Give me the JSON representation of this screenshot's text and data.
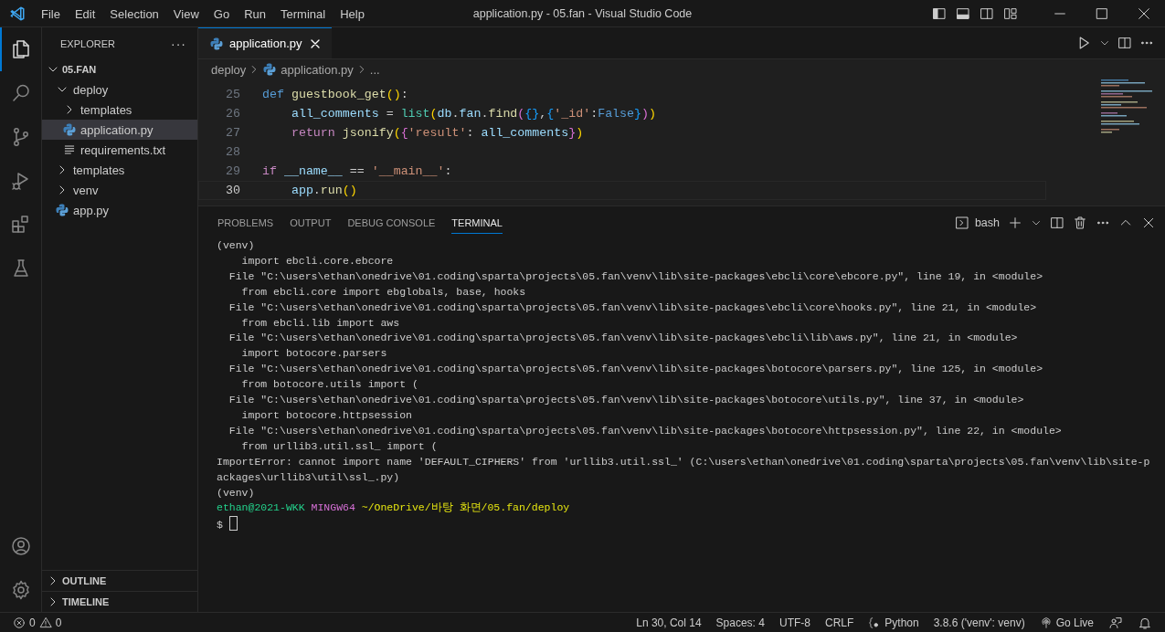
{
  "title_bar": {
    "menu": [
      "File",
      "Edit",
      "Selection",
      "View",
      "Go",
      "Run",
      "Terminal",
      "Help"
    ],
    "title": "application.py - 05.fan - Visual Studio Code"
  },
  "activity_bar": {
    "top": [
      {
        "kind": "explorer",
        "selected": true
      },
      {
        "kind": "search",
        "selected": false
      },
      {
        "kind": "source-control",
        "selected": false
      },
      {
        "kind": "run-debug",
        "selected": false
      },
      {
        "kind": "extensions",
        "selected": false
      },
      {
        "kind": "testing",
        "selected": false
      }
    ],
    "bottom": [
      {
        "kind": "accounts"
      },
      {
        "kind": "settings"
      }
    ]
  },
  "sidebar": {
    "title": "EXPLORER",
    "more": "···",
    "root": {
      "label": "05.FAN",
      "expanded": true
    },
    "items": [
      {
        "label": "deploy",
        "kind": "folder",
        "expanded": true,
        "selected": false,
        "children": [
          {
            "label": "templates",
            "kind": "folder",
            "expanded": false,
            "selected": false
          },
          {
            "label": "application.py",
            "kind": "python",
            "selected": true
          },
          {
            "label": "requirements.txt",
            "kind": "text",
            "selected": false
          }
        ]
      },
      {
        "label": "templates",
        "kind": "folder",
        "expanded": false,
        "selected": false
      },
      {
        "label": "venv",
        "kind": "folder",
        "expanded": false,
        "selected": false
      },
      {
        "label": "app.py",
        "kind": "python",
        "selected": false
      }
    ],
    "sections": [
      {
        "label": "OUTLINE",
        "expanded": false
      },
      {
        "label": "TIMELINE",
        "expanded": false
      }
    ]
  },
  "editor": {
    "tabs": [
      {
        "label": "application.py",
        "kind": "python",
        "selected": true
      }
    ],
    "breadcrumb": [
      {
        "label": "deploy",
        "kind": "folder"
      },
      {
        "label": "application.py",
        "kind": "python"
      },
      {
        "label": "...",
        "kind": "more"
      }
    ],
    "lines": [
      {
        "number": "25",
        "current": false,
        "tokens": [
          {
            "text": "def ",
            "kind": "keyword"
          },
          {
            "text": "guestbook_get",
            "kind": "function"
          },
          {
            "text": "()",
            "kind": "bracket1"
          },
          {
            "text": ":",
            "kind": "plain"
          }
        ]
      },
      {
        "number": "26",
        "current": false,
        "tokens": [
          {
            "text": "    all_comments",
            "kind": "variable"
          },
          {
            "text": " = ",
            "kind": "plain"
          },
          {
            "text": "list",
            "kind": "class"
          },
          {
            "text": "(",
            "kind": "bracket1"
          },
          {
            "text": "db",
            "kind": "variable"
          },
          {
            "text": ".",
            "kind": "plain"
          },
          {
            "text": "fan",
            "kind": "variable"
          },
          {
            "text": ".",
            "kind": "plain"
          },
          {
            "text": "find",
            "kind": "function"
          },
          {
            "text": "(",
            "kind": "bracket2"
          },
          {
            "text": "{}",
            "kind": "bracket3"
          },
          {
            "text": ",",
            "kind": "plain"
          },
          {
            "text": "{",
            "kind": "bracket3"
          },
          {
            "text": "'_id'",
            "kind": "string"
          },
          {
            "text": ":",
            "kind": "plain"
          },
          {
            "text": "False",
            "kind": "keyword"
          },
          {
            "text": "}",
            "kind": "bracket3"
          },
          {
            "text": ")",
            "kind": "bracket2"
          },
          {
            "text": ")",
            "kind": "bracket1"
          }
        ]
      },
      {
        "number": "27",
        "current": false,
        "tokens": [
          {
            "text": "    return ",
            "kind": "control"
          },
          {
            "text": "jsonify",
            "kind": "function"
          },
          {
            "text": "(",
            "kind": "bracket1"
          },
          {
            "text": "{",
            "kind": "bracket2"
          },
          {
            "text": "'result'",
            "kind": "string"
          },
          {
            "text": ": ",
            "kind": "plain"
          },
          {
            "text": "all_comments",
            "kind": "variable"
          },
          {
            "text": "}",
            "kind": "bracket2"
          },
          {
            "text": ")",
            "kind": "bracket1"
          }
        ]
      },
      {
        "number": "28",
        "current": false
      },
      {
        "number": "29",
        "current": false,
        "tokens": [
          {
            "text": "if ",
            "kind": "control"
          },
          {
            "text": "__name__",
            "kind": "variable"
          },
          {
            "text": " == ",
            "kind": "plain"
          },
          {
            "text": "'__main__'",
            "kind": "string"
          },
          {
            "text": ":",
            "kind": "plain"
          }
        ]
      },
      {
        "number": "30",
        "current": true,
        "tokens": [
          {
            "text": "    app",
            "kind": "variable"
          },
          {
            "text": ".",
            "kind": "plain"
          },
          {
            "text": "run",
            "kind": "function"
          },
          {
            "text": "()",
            "kind": "bracket1"
          }
        ]
      }
    ]
  },
  "panel": {
    "tabs": [
      {
        "label": "PROBLEMS",
        "selected": false
      },
      {
        "label": "OUTPUT",
        "selected": false
      },
      {
        "label": "DEBUG CONSOLE",
        "selected": false
      },
      {
        "label": "TERMINAL",
        "selected": true
      }
    ],
    "shell": "bash",
    "terminal": [
      {
        "kind": "output",
        "text": "(venv)"
      },
      {
        "kind": "output",
        "text": "    import ebcli.core.ebcore"
      },
      {
        "kind": "output",
        "text": "  File \"C:\\users\\ethan\\onedrive\\01.coding\\sparta\\projects\\05.fan\\venv\\lib\\site-packages\\ebcli\\core\\ebcore.py\", line 19, in <module>"
      },
      {
        "kind": "output",
        "text": "    from ebcli.core import ebglobals, base, hooks"
      },
      {
        "kind": "output",
        "text": "  File \"C:\\users\\ethan\\onedrive\\01.coding\\sparta\\projects\\05.fan\\venv\\lib\\site-packages\\ebcli\\core\\hooks.py\", line 21, in <module>"
      },
      {
        "kind": "output",
        "text": "    from ebcli.lib import aws"
      },
      {
        "kind": "output",
        "text": "  File \"C:\\users\\ethan\\onedrive\\01.coding\\sparta\\projects\\05.fan\\venv\\lib\\site-packages\\ebcli\\lib\\aws.py\", line 21, in <module>"
      },
      {
        "kind": "output",
        "text": "    import botocore.parsers"
      },
      {
        "kind": "output",
        "text": "  File \"C:\\users\\ethan\\onedrive\\01.coding\\sparta\\projects\\05.fan\\venv\\lib\\site-packages\\botocore\\parsers.py\", line 125, in <module>"
      },
      {
        "kind": "output",
        "text": "    from botocore.utils import ("
      },
      {
        "kind": "output",
        "text": "  File \"C:\\users\\ethan\\onedrive\\01.coding\\sparta\\projects\\05.fan\\venv\\lib\\site-packages\\botocore\\utils.py\", line 37, in <module>"
      },
      {
        "kind": "output",
        "text": "    import botocore.httpsession"
      },
      {
        "kind": "output",
        "text": "  File \"C:\\users\\ethan\\onedrive\\01.coding\\sparta\\projects\\05.fan\\venv\\lib\\site-packages\\botocore\\httpsession.py\", line 22, in <module>"
      },
      {
        "kind": "output",
        "text": "    from urllib3.util.ssl_ import ("
      },
      {
        "kind": "output",
        "text": "ImportError: cannot import name 'DEFAULT_CIPHERS' from 'urllib3.util.ssl_' (C:\\users\\ethan\\onedrive\\01.coding\\sparta\\projects\\05.fan\\venv\\lib\\site-packages\\urllib3\\util\\ssl_.py)"
      },
      {
        "kind": "output",
        "text": "(venv)"
      },
      {
        "kind": "prompt",
        "user": "ethan@2021-WKK",
        "host": "MINGW64",
        "path": "~/OneDrive/바탕 화면/05.fan/deploy"
      },
      {
        "kind": "input",
        "text": "$"
      }
    ]
  },
  "status_bar": {
    "errors": "0",
    "warnings": "0",
    "items": [
      {
        "kind": "text",
        "text": "Ln 30, Col 14"
      },
      {
        "kind": "text",
        "text": "Spaces: 4"
      },
      {
        "kind": "text",
        "text": "UTF-8"
      },
      {
        "kind": "text",
        "text": "CRLF"
      },
      {
        "kind": "language",
        "text": "Python"
      },
      {
        "kind": "text",
        "text": "3.8.6 ('venv': venv)"
      },
      {
        "kind": "golive",
        "text": "Go Live"
      },
      {
        "kind": "feedback"
      },
      {
        "kind": "bell"
      }
    ]
  }
}
